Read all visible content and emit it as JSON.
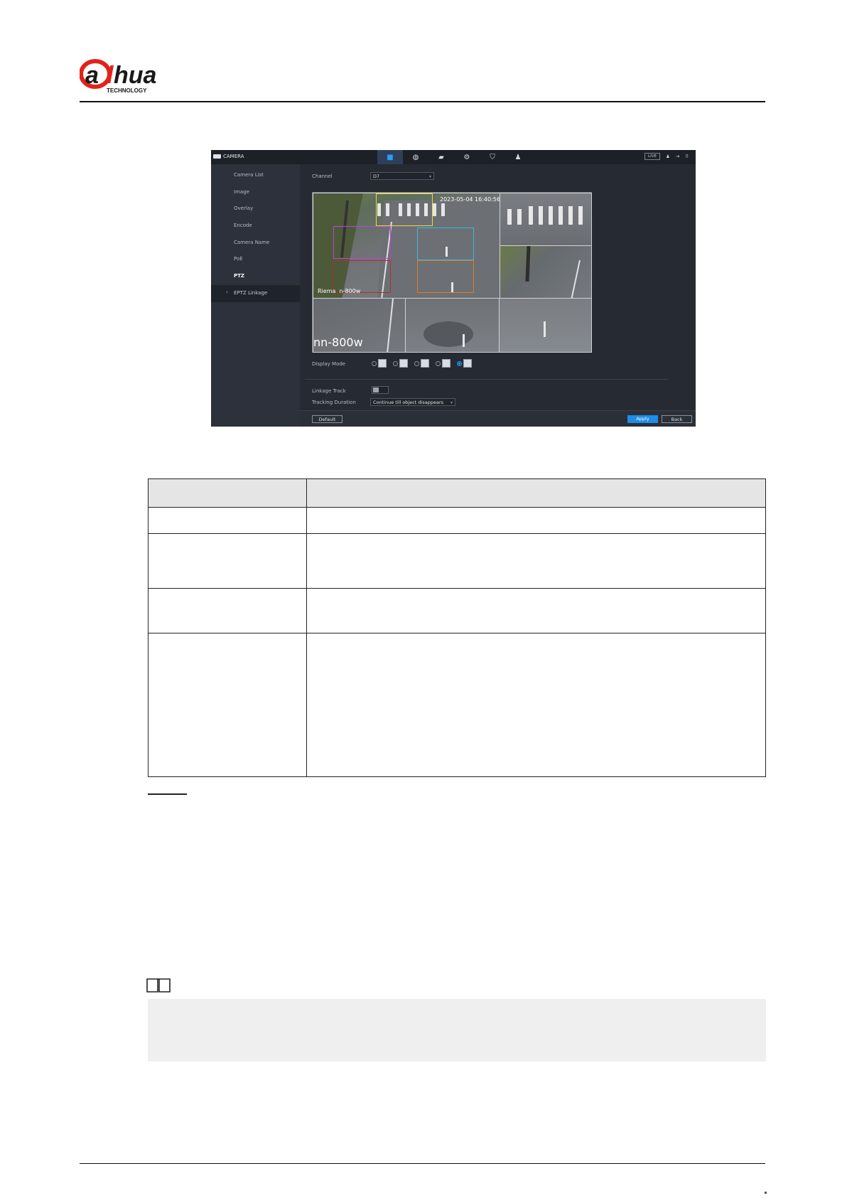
{
  "brand": {
    "logo_text": "alhua",
    "logo_subtext": "TECHNOLOGY",
    "logo_color_red": "#e2231a",
    "logo_color_dark": "#1a1a1a"
  },
  "screenshot": {
    "title": "CAMERA",
    "live_badge": "LIVE",
    "nav_icons": [
      "camera-icon",
      "network-icon",
      "storage-icon",
      "system-icon",
      "security-icon",
      "account-icon"
    ],
    "sidebar": {
      "items": [
        "Camera List",
        "Image",
        "Overlay",
        "Encode",
        "Camera Name",
        "PoE",
        "PTZ",
        "EPTZ Linkage"
      ]
    },
    "channel": {
      "label": "Channel",
      "value": "D7"
    },
    "video": {
      "timestamp": "2023-05-04 16:40:56",
      "cell_label_small": "Riema  n-800w",
      "cell_label_large": "nn-800w",
      "roi_colors": [
        "#e8d93a",
        "#c040d8",
        "#3ab6e8",
        "#b32c2c",
        "#e07a1c"
      ]
    },
    "display_mode": {
      "label": "Display Mode",
      "options_count": 5,
      "selected_index": 4
    },
    "linkage_track": {
      "label": "Linkage Track",
      "enabled": false
    },
    "tracking_duration": {
      "label": "Tracking Duration",
      "value": "Continue till object disappears"
    },
    "buttons": {
      "default": "Default",
      "apply": "Apply",
      "back": "Back"
    },
    "accent_color": "#1c8de8"
  }
}
